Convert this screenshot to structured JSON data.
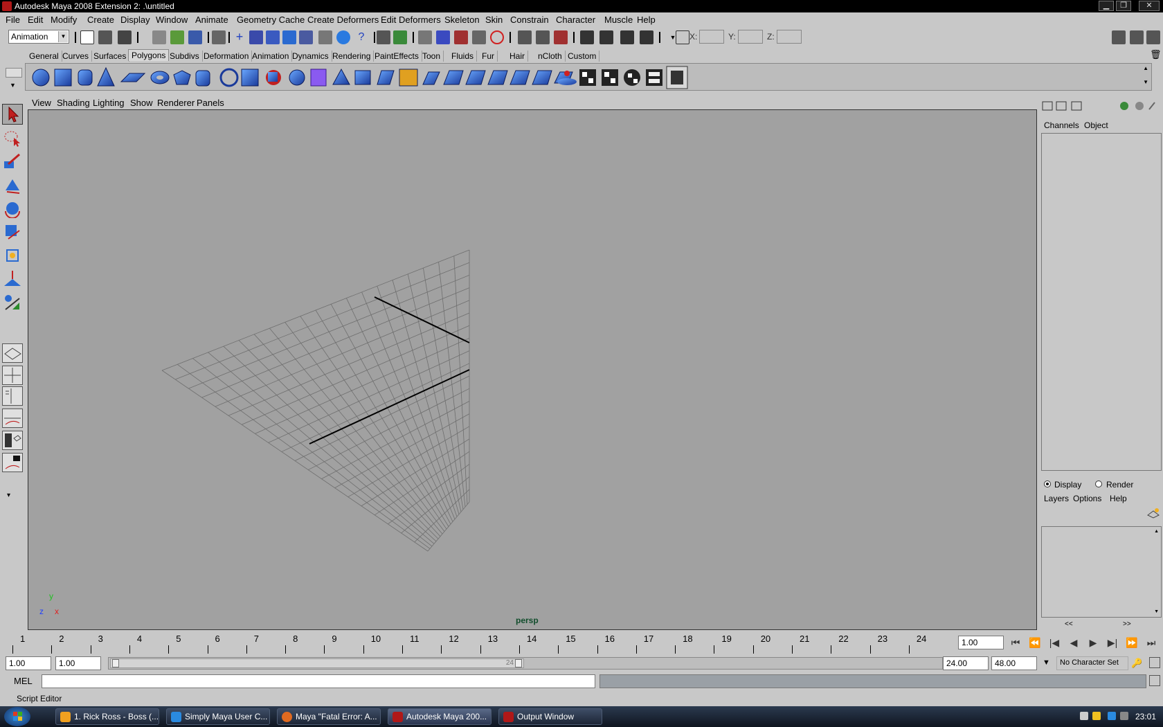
{
  "window": {
    "title": "Autodesk Maya 2008 Extension 2: .\\untitled"
  },
  "menubar": [
    "File",
    "Edit",
    "Modify",
    "Create",
    "Display",
    "Window",
    "Animate",
    "Geometry Cache",
    "Create Deformers",
    "Edit Deformers",
    "Skeleton",
    "Skin",
    "Constrain",
    "Character",
    "Muscle",
    "Help"
  ],
  "statusline": {
    "menu_set": "Animation",
    "x_label": "X:",
    "y_label": "Y:",
    "z_label": "Z:"
  },
  "shelf": {
    "tabs": [
      "General",
      "Curves",
      "Surfaces",
      "Polygons",
      "Subdivs",
      "Deformation",
      "Animation",
      "Dynamics",
      "Rendering",
      "PaintEffects",
      "Toon",
      "Fluids",
      "Fur",
      "Hair",
      "nCloth",
      "Custom"
    ],
    "active_tab": "Polygons"
  },
  "panel": {
    "menus": [
      "View",
      "Shading",
      "Lighting",
      "Show",
      "Renderer",
      "Panels"
    ],
    "camera_label": "persp",
    "axis_labels": {
      "y": "y",
      "z": "z",
      "x": "x"
    }
  },
  "channelbox": {
    "menus": [
      "Channels",
      "Object"
    ]
  },
  "layers": {
    "modes": [
      "Display",
      "Render"
    ],
    "selected_mode": "Display",
    "menus": [
      "Layers",
      "Options",
      "Help"
    ],
    "scroll_left": "<<",
    "scroll_right": ">>"
  },
  "timeslider": {
    "ticks": [
      "1",
      "2",
      "3",
      "4",
      "5",
      "6",
      "7",
      "8",
      "9",
      "10",
      "11",
      "12",
      "13",
      "14",
      "15",
      "16",
      "17",
      "18",
      "19",
      "20",
      "21",
      "22",
      "23",
      "24"
    ],
    "current_time": "1.00"
  },
  "rangeslider": {
    "start_time": "1.00",
    "playback_start": "1.00",
    "playback_end": "24.00",
    "end_time": "48.00",
    "range_label": "24",
    "character_set": "No Character Set"
  },
  "commandline": {
    "label": "MEL",
    "value": ""
  },
  "helpline": {
    "text": "Script Editor"
  },
  "taskbar": {
    "items": [
      "1. Rick Ross - Boss (...",
      "Simply Maya User C...",
      "Maya \"Fatal Error: A...",
      "Autodesk Maya 200...",
      "Output Window"
    ],
    "active_index": 3,
    "clock": "23:01"
  },
  "colors": {
    "viewport_bg": "#a1a1a1",
    "grid_line": "#6e6e6e",
    "axis_line": "#000000",
    "ui_bg": "#c8c8c8",
    "persp_label": "#114d2c",
    "axis_y": "#22c022",
    "axis_z": "#2040ff",
    "axis_x": "#e02020"
  }
}
